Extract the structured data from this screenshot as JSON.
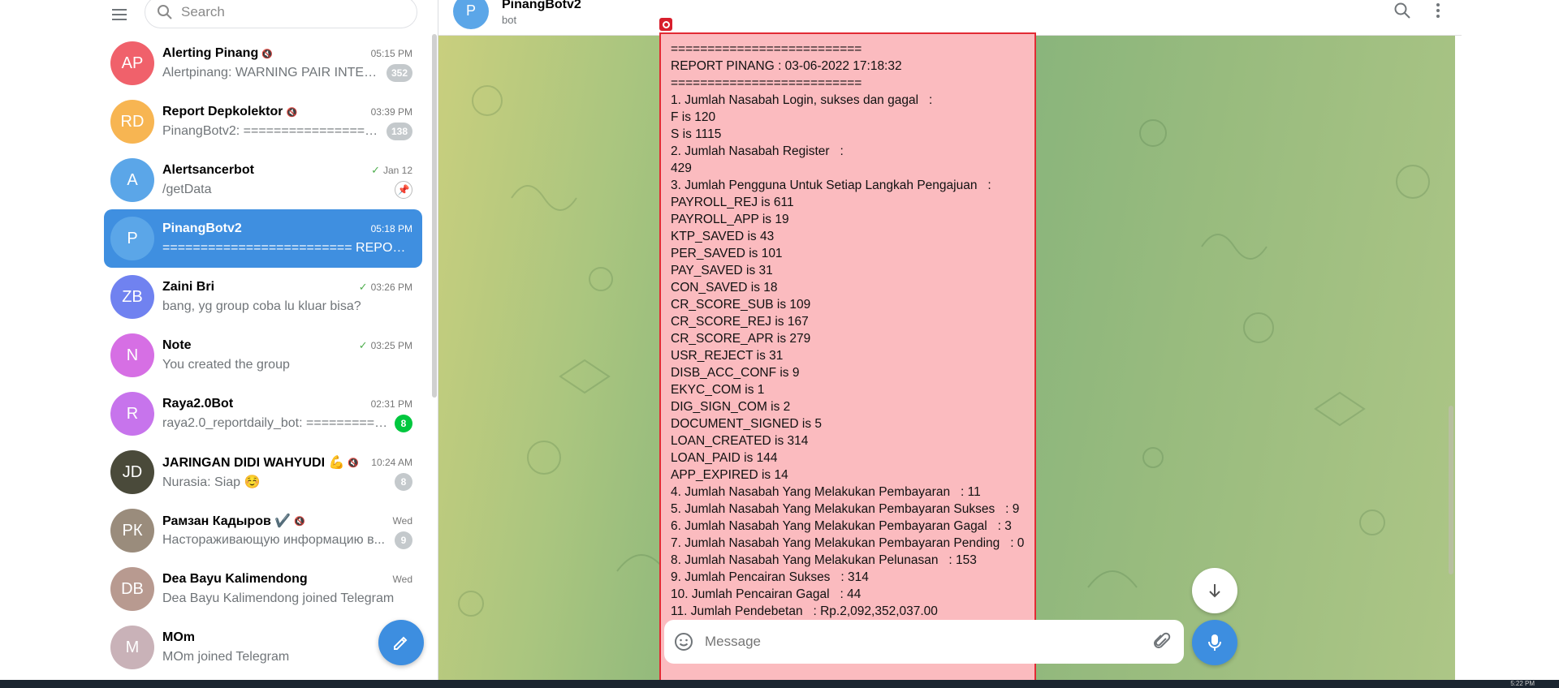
{
  "search": {
    "placeholder": "Search"
  },
  "chats": [
    {
      "initials": "AP",
      "color": "#f0616b",
      "title": "Alerting Pinang",
      "muted": true,
      "time": "05:15 PM",
      "check": false,
      "preview": "Alertpinang: WARNING PAIR INTER...",
      "badge": "352",
      "badge_type": "gray"
    },
    {
      "initials": "RD",
      "color": "#f7b552",
      "title": "Report Depkolektor",
      "muted": true,
      "time": "03:39 PM",
      "check": false,
      "preview": "PinangBotv2: ===================...",
      "badge": "138",
      "badge_type": "gray"
    },
    {
      "initials": "A",
      "color": "#5ba6e8",
      "title": "Alertsancerbot",
      "muted": false,
      "time": "Jan 12",
      "check": true,
      "preview": "/getData",
      "badge": "",
      "badge_type": "pin"
    },
    {
      "initials": "P",
      "color": "#5ba6e8",
      "title": "PinangBotv2",
      "muted": false,
      "time": "05:18 PM",
      "check": false,
      "preview": "========================= REPORT ...",
      "badge": "",
      "badge_type": "none",
      "active": true
    },
    {
      "initials": "ZB",
      "color": "#7082f0",
      "title": "Zaini Bri",
      "muted": false,
      "time": "03:26 PM",
      "check": true,
      "preview": "bang, yg group coba lu kluar bisa?",
      "badge": "",
      "badge_type": "none"
    },
    {
      "initials": "N",
      "color": "#d66fe4",
      "title": "Note",
      "muted": false,
      "time": "03:25 PM",
      "check": true,
      "preview": "You created the group",
      "badge": "",
      "badge_type": "none"
    },
    {
      "initials": "R",
      "color": "#c774ec",
      "title": "Raya2.0Bot",
      "muted": false,
      "time": "02:31 PM",
      "check": false,
      "preview": "raya2.0_reportdaily_bot: ==========...",
      "badge": "8",
      "badge_type": "green"
    },
    {
      "initials": "JD",
      "color": "#4a4a3a",
      "title": "JARINGAN DIDI WAHYUDI 💪",
      "muted": true,
      "time": "10:24 AM",
      "check": false,
      "preview": "Nurasia: Siap ☺️",
      "badge": "8",
      "badge_type": "gray"
    },
    {
      "initials": "РК",
      "color": "#9a8c7c",
      "title": "Рамзан Кадыров ✔️",
      "muted": true,
      "time": "Wed",
      "check": false,
      "preview": "Настораживающую информацию в...",
      "badge": "9",
      "badge_type": "gray"
    },
    {
      "initials": "DB",
      "color": "#b89a90",
      "title": "Dea Bayu Kalimendong",
      "muted": false,
      "time": "Wed",
      "check": false,
      "preview": "Dea Bayu Kalimendong joined Telegram",
      "badge": "",
      "badge_type": "none"
    },
    {
      "initials": "M",
      "color": "#c9b2b8",
      "title": "MOm",
      "muted": false,
      "time": "",
      "check": false,
      "preview": "MOm joined Telegram",
      "badge": "",
      "badge_type": "none"
    }
  ],
  "header": {
    "name": "PinangBotv2",
    "status": "bot",
    "avatar_initial": "P"
  },
  "message_lines": [
    "==========================",
    "REPORT PINANG : 03-06-2022 17:18:32",
    "==========================",
    "1. Jumlah Nasabah Login, sukses dan gagal   :",
    "F is 120",
    "S is 1115",
    "2. Jumlah Nasabah Register   :",
    "429",
    "3. Jumlah Pengguna Untuk Setiap Langkah Pengajuan   :",
    "PAYROLL_REJ is 611",
    "PAYROLL_APP is 19",
    "KTP_SAVED is 43",
    "PER_SAVED is 101",
    "PAY_SAVED is 31",
    "CON_SAVED is 18",
    "CR_SCORE_SUB is 109",
    "CR_SCORE_REJ is 167",
    "CR_SCORE_APR is 279",
    "USR_REJECT is 31",
    "DISB_ACC_CONF is 9",
    "EKYC_COM is 1",
    "DIG_SIGN_COM is 2",
    "DOCUMENT_SIGNED is 5",
    "LOAN_CREATED is 314",
    "LOAN_PAID is 144",
    "APP_EXPIRED is 14",
    "4. Jumlah Nasabah Yang Melakukan Pembayaran   : 11",
    "5. Jumlah Nasabah Yang Melakukan Pembayaran Sukses   : 9",
    "6. Jumlah Nasabah Yang Melakukan Pembayaran Gagal   : 3",
    "7. Jumlah Nasabah Yang Melakukan Pembayaran Pending   : 0",
    "8. Jumlah Nasabah Yang Melakukan Pelunasan   : 153",
    "9. Jumlah Pencairan Sukses   : 314",
    "10. Jumlah Pencairan Gagal   : 44",
    "11. Jumlah Pendebetan   : Rp.2,092,352,037.00"
  ],
  "composer": {
    "placeholder": "Message"
  },
  "taskbar": {
    "time": "5:22 PM"
  },
  "icons": [
    "menu-icon",
    "search-icon",
    "more-icon",
    "pencil-icon",
    "emoji-icon",
    "paperclip-icon",
    "microphone-icon",
    "arrow-down-icon",
    "record-icon",
    "pin-icon",
    "mute-icon",
    "check-icon"
  ]
}
